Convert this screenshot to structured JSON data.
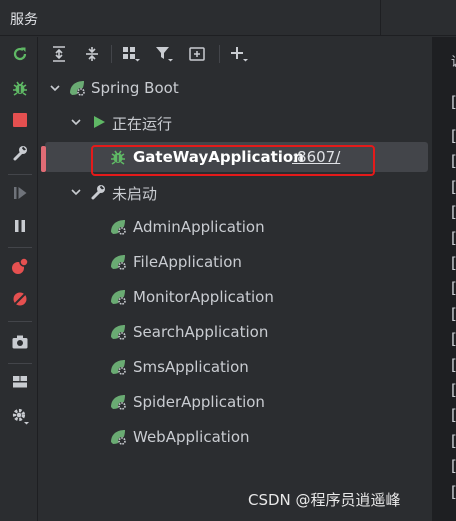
{
  "window": {
    "title": "服务"
  },
  "tree": {
    "root": {
      "label": "Spring Boot"
    },
    "running_group": {
      "label": "正在运行"
    },
    "running_app": {
      "label": "GateWayApplication",
      "port_link": ":8607/"
    },
    "stopped_group": {
      "label": "未启动"
    },
    "stopped_apps": [
      {
        "label": "AdminApplication"
      },
      {
        "label": "FileApplication"
      },
      {
        "label": "MonitorApplication"
      },
      {
        "label": "SearchApplication"
      },
      {
        "label": "SmsApplication"
      },
      {
        "label": "SpiderApplication"
      },
      {
        "label": "WebApplication"
      }
    ]
  },
  "right_panel": {
    "partial_char": "调",
    "bracket": "["
  },
  "watermark": "CSDN @程序员逍遥峰",
  "colors": {
    "background": "#2b2d30",
    "selection": "#43454a",
    "highlight_box": "#e41a1a",
    "spring_green": "#6aab73",
    "stop_red": "#e55050",
    "run_green": "#5fb865"
  }
}
